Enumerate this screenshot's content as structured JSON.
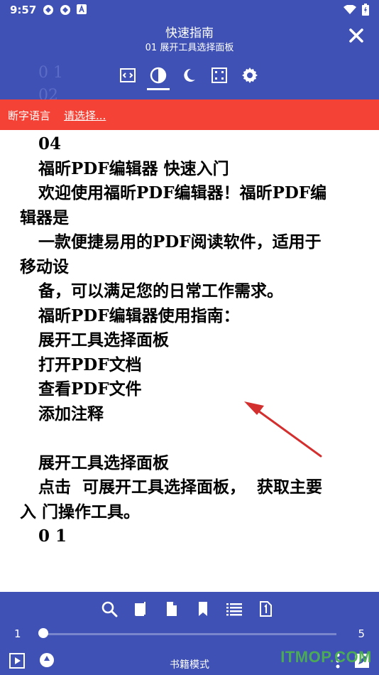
{
  "status_bar": {
    "time": "9:57"
  },
  "top_bar": {
    "title": "快速指南",
    "subtitle": "01 展开工具选择面板",
    "ghost_lines": [
      "0 1",
      "02"
    ]
  },
  "hyphenation": {
    "label": "断字语言",
    "select": "请选择..."
  },
  "content": {
    "lines": [
      {
        "text": "04",
        "indent": true
      },
      {
        "text": "福昕PDF编辑器 快速入门",
        "indent": true
      },
      {
        "text": "欢迎使用福昕PDF编辑器！福昕PDF编",
        "indent": true
      },
      {
        "text": "辑器是",
        "indent": false
      },
      {
        "text": "一款便捷易用的PDF阅读软件，适用于",
        "indent": true
      },
      {
        "text": "移动设",
        "indent": false
      },
      {
        "text": "备，可以满足您的日常工作需求。",
        "indent": true
      },
      {
        "text": "福昕PDF编辑器使用指南：",
        "indent": true
      },
      {
        "text": "展开工具选择面板",
        "indent": true
      },
      {
        "text": "打开PDF文档",
        "indent": true
      },
      {
        "text": "查看PDF文件",
        "indent": true
      },
      {
        "text": "添加注释",
        "indent": true
      },
      {
        "text": " ",
        "indent": true
      },
      {
        "text": "展开工具选择面板",
        "indent": true
      },
      {
        "text": "点击  可展开工具选择面板，  获取主要",
        "indent": true
      },
      {
        "text": "入 门操作工具。",
        "indent": false
      },
      {
        "text": "0 1",
        "indent": true
      }
    ]
  },
  "bottom_bar": {
    "page_start": "1",
    "page_end": "5",
    "mode_label": "书籍模式",
    "slider_position_fraction": 0
  },
  "watermark": "ITMOP.COM",
  "colors": {
    "primary": "#3f51b5",
    "hyphen_bar": "#f44336",
    "arrow": "#d32f2f",
    "watermark": "#4caf50"
  }
}
